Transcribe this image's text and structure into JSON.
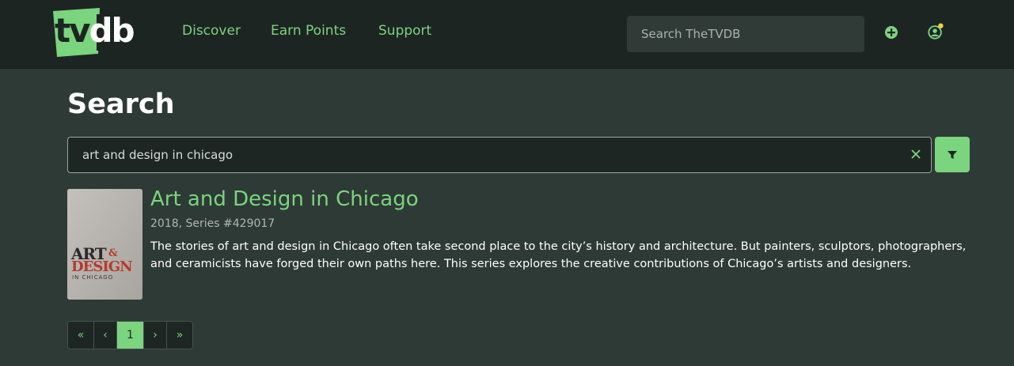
{
  "brand": {
    "logo_text": "tvdb"
  },
  "nav": {
    "links": [
      {
        "label": "Discover"
      },
      {
        "label": "Earn Points"
      },
      {
        "label": "Support"
      }
    ],
    "search_placeholder": "Search TheTVDB",
    "add_icon": "plus-circle-icon",
    "user_icon": "user-circle-icon"
  },
  "page": {
    "title": "Search"
  },
  "search": {
    "query": "art and design in chicago",
    "clear_icon": "close-icon",
    "filter_icon": "filter-icon"
  },
  "results": [
    {
      "title": "Art and Design in Chicago",
      "meta": "2018, Series #429017",
      "description": "The stories of art and design in Chicago often take second place to the city’s history and architecture. But painters, sculptors, photographers, and ceramicists have forged their own paths here. This series explores the creative contributions of Chicago’s artists and designers.",
      "poster": {
        "line1": "ART",
        "amp": "&",
        "line2": "DESIGN",
        "line3": "IN CHICAGO"
      }
    }
  ],
  "pagination": {
    "first": "«",
    "prev": "‹",
    "current": "1",
    "next": "›",
    "last": "»"
  },
  "colors": {
    "accent": "#7bd47e",
    "background": "#2e3a36",
    "navbar": "#1d2522",
    "notification_dot": "#f2d13a"
  }
}
